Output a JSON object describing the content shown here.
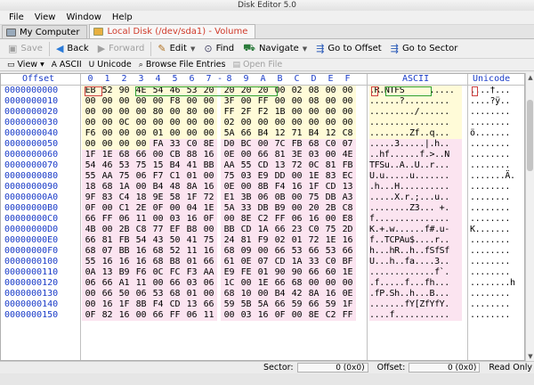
{
  "window": {
    "title": "Disk Editor 5.0"
  },
  "menu": [
    "File",
    "View",
    "Window",
    "Help"
  ],
  "tabs": [
    {
      "label": "My Computer",
      "active": false
    },
    {
      "label": "Local Disk (/dev/sda1) - Volume",
      "active": true
    }
  ],
  "toolbar": {
    "save": "Save",
    "back": "Back",
    "forward": "Forward",
    "edit": "Edit",
    "find": "Find",
    "navigate": "Navigate",
    "goto_offset": "Go to Offset",
    "goto_sector": "Go to Sector"
  },
  "viewbar": {
    "view": "View",
    "ascii": "ASCII",
    "unicode": "Unicode",
    "browse": "Browse File Entries",
    "open_file": "Open File"
  },
  "columns": {
    "offset": "Offset",
    "hex": [
      "0",
      "1",
      "2",
      "3",
      "4",
      "5",
      "6",
      "7",
      "-",
      "8",
      "9",
      "A",
      "B",
      "C",
      "D",
      "E",
      "F"
    ],
    "ascii": "ASCII",
    "unicode": "Unicode"
  },
  "rows": [
    {
      "off": "0000000000",
      "hex": [
        "EB",
        "52",
        "90",
        "4E",
        "54",
        "46",
        "53",
        "20",
        "20",
        "20",
        "20",
        "00",
        "02",
        "08",
        "00",
        "00"
      ],
      "ascii": ".R.NTFS     .....",
      "uni": "....†...",
      "zone": "y"
    },
    {
      "off": "0000000010",
      "hex": [
        "00",
        "00",
        "00",
        "00",
        "00",
        "F8",
        "00",
        "00",
        "3F",
        "00",
        "FF",
        "00",
        "00",
        "08",
        "00",
        "00"
      ],
      "ascii": "......?.........",
      "uni": "....?ÿ..",
      "zone": "y"
    },
    {
      "off": "0000000020",
      "hex": [
        "00",
        "00",
        "00",
        "00",
        "80",
        "00",
        "80",
        "00",
        "FF",
        "2F",
        "F2",
        "1B",
        "00",
        "00",
        "00",
        "00"
      ],
      "ascii": "........./......",
      "uni": "........",
      "zone": "y"
    },
    {
      "off": "0000000030",
      "hex": [
        "00",
        "00",
        "0C",
        "00",
        "00",
        "00",
        "00",
        "00",
        "02",
        "00",
        "00",
        "00",
        "00",
        "00",
        "00",
        "00"
      ],
      "ascii": "................",
      "uni": "........",
      "zone": "y"
    },
    {
      "off": "0000000040",
      "hex": [
        "F6",
        "00",
        "00",
        "00",
        "01",
        "00",
        "00",
        "00",
        "5A",
        "66",
        "B4",
        "12",
        "71",
        "B4",
        "12",
        "C8"
      ],
      "ascii": "........Zf..q...",
      "uni": "ö.......",
      "zone": "y"
    },
    {
      "off": "0000000050",
      "hex": [
        "00",
        "00",
        "00",
        "00",
        "FA",
        "33",
        "C0",
        "8E",
        "D0",
        "BC",
        "00",
        "7C",
        "FB",
        "68",
        "C0",
        "07"
      ],
      "ascii": ".....3.....|.h..",
      "uni": "........",
      "zone": "yp"
    },
    {
      "off": "0000000060",
      "hex": [
        "1F",
        "1E",
        "68",
        "66",
        "00",
        "CB",
        "88",
        "16",
        "0E",
        "00",
        "66",
        "81",
        "3E",
        "03",
        "00",
        "4E"
      ],
      "ascii": "..hf......f.>..N",
      "uni": "........",
      "zone": "p"
    },
    {
      "off": "0000000070",
      "hex": [
        "54",
        "46",
        "53",
        "75",
        "15",
        "B4",
        "41",
        "BB",
        "AA",
        "55",
        "CD",
        "13",
        "72",
        "0C",
        "81",
        "FB"
      ],
      "ascii": "TFSu..A..U..r...",
      "uni": "........",
      "zone": "p"
    },
    {
      "off": "0000000080",
      "hex": [
        "55",
        "AA",
        "75",
        "06",
        "F7",
        "C1",
        "01",
        "00",
        "75",
        "03",
        "E9",
        "DD",
        "00",
        "1E",
        "83",
        "EC"
      ],
      "ascii": "U.u.....u.......",
      "uni": ".......Ä.",
      "zone": "p"
    },
    {
      "off": "0000000090",
      "hex": [
        "18",
        "68",
        "1A",
        "00",
        "B4",
        "48",
        "8A",
        "16",
        "0E",
        "00",
        "8B",
        "F4",
        "16",
        "1F",
        "CD",
        "13"
      ],
      "ascii": ".h...H..........",
      "uni": "........",
      "zone": "p"
    },
    {
      "off": "00000000A0",
      "hex": [
        "9F",
        "83",
        "C4",
        "18",
        "9E",
        "58",
        "1F",
        "72",
        "E1",
        "3B",
        "06",
        "0B",
        "00",
        "75",
        "DB",
        "A3"
      ],
      "ascii": ".....X.r.;...u..",
      "uni": "........",
      "zone": "p"
    },
    {
      "off": "00000000B0",
      "hex": [
        "0F",
        "00",
        "C1",
        "2E",
        "0F",
        "00",
        "04",
        "1E",
        "5A",
        "33",
        "DB",
        "B9",
        "00",
        "20",
        "2B",
        "C8"
      ],
      "ascii": "........Z3... +.",
      "uni": "........",
      "zone": "p"
    },
    {
      "off": "00000000C0",
      "hex": [
        "66",
        "FF",
        "06",
        "11",
        "00",
        "03",
        "16",
        "0F",
        "00",
        "8E",
        "C2",
        "FF",
        "06",
        "16",
        "00",
        "E8"
      ],
      "ascii": "f...............",
      "uni": "........",
      "zone": "p"
    },
    {
      "off": "00000000D0",
      "hex": [
        "4B",
        "00",
        "2B",
        "C8",
        "77",
        "EF",
        "B8",
        "00",
        "BB",
        "CD",
        "1A",
        "66",
        "23",
        "C0",
        "75",
        "2D"
      ],
      "ascii": "K.+.w......f#.u-",
      "uni": "K.......",
      "zone": "p"
    },
    {
      "off": "00000000E0",
      "hex": [
        "66",
        "81",
        "FB",
        "54",
        "43",
        "50",
        "41",
        "75",
        "24",
        "81",
        "F9",
        "02",
        "01",
        "72",
        "1E",
        "16"
      ],
      "ascii": "f..TCPAu$....r..",
      "uni": "........",
      "zone": "p"
    },
    {
      "off": "00000000F0",
      "hex": [
        "68",
        "07",
        "BB",
        "16",
        "68",
        "52",
        "11",
        "16",
        "68",
        "09",
        "00",
        "66",
        "53",
        "66",
        "53",
        "66"
      ],
      "ascii": "h...hR..h..fSfSf",
      "uni": "........",
      "zone": "p"
    },
    {
      "off": "0000000100",
      "hex": [
        "55",
        "16",
        "16",
        "16",
        "68",
        "B8",
        "01",
        "66",
        "61",
        "0E",
        "07",
        "CD",
        "1A",
        "33",
        "C0",
        "BF"
      ],
      "ascii": "U...h..fa....3..",
      "uni": "........",
      "zone": "p"
    },
    {
      "off": "0000000110",
      "hex": [
        "0A",
        "13",
        "B9",
        "F6",
        "0C",
        "FC",
        "F3",
        "AA",
        "E9",
        "FE",
        "01",
        "90",
        "90",
        "66",
        "60",
        "1E"
      ],
      "ascii": ".............f`.",
      "uni": "........",
      "zone": "p"
    },
    {
      "off": "0000000120",
      "hex": [
        "06",
        "66",
        "A1",
        "11",
        "00",
        "66",
        "03",
        "06",
        "1C",
        "00",
        "1E",
        "66",
        "68",
        "00",
        "00",
        "00"
      ],
      "ascii": ".f.....f...fh...",
      "uni": "........h",
      "zone": "p"
    },
    {
      "off": "0000000130",
      "hex": [
        "00",
        "66",
        "50",
        "06",
        "53",
        "68",
        "01",
        "00",
        "68",
        "10",
        "00",
        "B4",
        "42",
        "8A",
        "16",
        "0E"
      ],
      "ascii": ".fP.Sh..h...B...",
      "uni": "........",
      "zone": "p"
    },
    {
      "off": "0000000140",
      "hex": [
        "00",
        "16",
        "1F",
        "8B",
        "F4",
        "CD",
        "13",
        "66",
        "59",
        "5B",
        "5A",
        "66",
        "59",
        "66",
        "59",
        "1F"
      ],
      "ascii": ".......fY[ZfYfY.",
      "uni": "........",
      "zone": "p"
    },
    {
      "off": "0000000150",
      "hex": [
        "0F",
        "82",
        "16",
        "00",
        "66",
        "FF",
        "06",
        "11",
        "00",
        "03",
        "16",
        "0F",
        "00",
        "8E",
        "C2",
        "FF"
      ],
      "ascii": "....f...........",
      "uni": "........",
      "zone": "p"
    }
  ],
  "status": {
    "sector_label": "Sector:",
    "sector_value": "0 (0x0)",
    "offset_label": "Offset:",
    "offset_value": "0 (0x0)",
    "mode": "Read Only"
  }
}
